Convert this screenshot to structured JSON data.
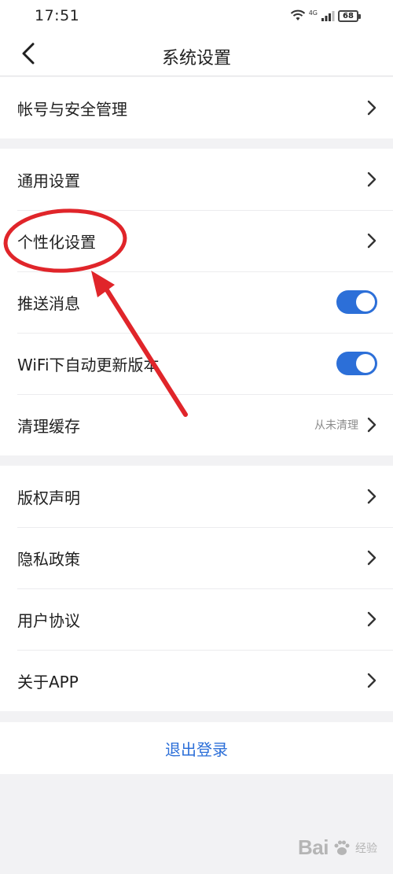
{
  "status_bar": {
    "time": "17:51",
    "network": "4G",
    "battery": "68"
  },
  "nav": {
    "title": "系统设置",
    "back_icon": "chevron-left-icon"
  },
  "groups": [
    {
      "items": [
        {
          "label": "帐号与安全管理",
          "type": "link"
        }
      ]
    },
    {
      "items": [
        {
          "label": "通用设置",
          "type": "link"
        },
        {
          "label": "个性化设置",
          "type": "link",
          "highlighted": true
        },
        {
          "label": "推送消息",
          "type": "toggle",
          "on": true
        },
        {
          "label": "WiFi下自动更新版本",
          "type": "toggle",
          "on": true
        },
        {
          "label": "清理缓存",
          "type": "link",
          "value": "从未清理"
        }
      ]
    },
    {
      "items": [
        {
          "label": "版权声明",
          "type": "link"
        },
        {
          "label": "隐私政策",
          "type": "link"
        },
        {
          "label": "用户协议",
          "type": "link"
        },
        {
          "label": "关于APP",
          "type": "link"
        }
      ]
    }
  ],
  "logout": {
    "label": "退出登录"
  },
  "watermark": {
    "brand": "Bai",
    "sub": "经验"
  },
  "colors": {
    "accent": "#2c6fd8",
    "annotation": "#e0252a",
    "background": "#f2f2f4"
  }
}
